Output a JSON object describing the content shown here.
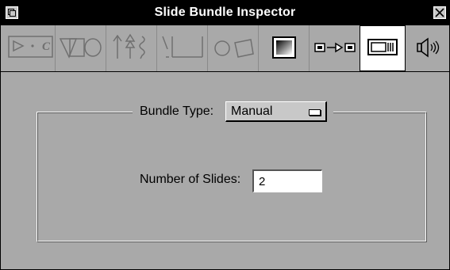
{
  "window": {
    "title": "Slide Bundle Inspector"
  },
  "toolbar": {
    "tools": [
      {
        "icon": "play-connector-tool-icon",
        "selected": false
      },
      {
        "icon": "shapes-tool-icon",
        "selected": false
      },
      {
        "icon": "arrows-tool-icon",
        "selected": false
      },
      {
        "icon": "lines-tool-icon",
        "selected": false
      },
      {
        "icon": "circle-shapes-tool-icon",
        "selected": false
      },
      {
        "icon": "gradient-fill-tool-icon",
        "selected": false
      },
      {
        "icon": "transition-tool-icon",
        "selected": false
      },
      {
        "icon": "slide-bundle-tool-icon",
        "selected": true
      },
      {
        "icon": "speaker-sound-tool-icon",
        "selected": false
      }
    ]
  },
  "bundle": {
    "type_label": "Bundle Type:",
    "type_value": "Manual",
    "slides_label": "Number of Slides:",
    "slides_value": "2"
  }
}
